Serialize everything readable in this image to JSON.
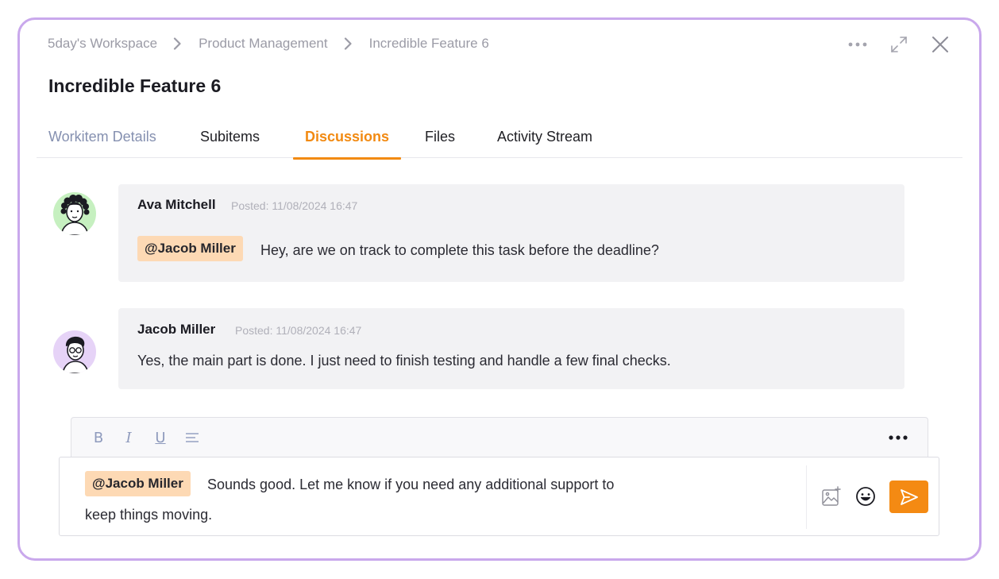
{
  "breadcrumb": {
    "items": [
      "5day's Workspace",
      "Product Management",
      "Incredible Feature 6"
    ]
  },
  "header": {
    "title": "Incredible Feature 6",
    "icons": [
      "more-horizontal-icon",
      "expand-icon",
      "close-icon"
    ]
  },
  "tabs": [
    {
      "label": "Workitem Details",
      "state": "dim"
    },
    {
      "label": "Subitems",
      "state": "normal"
    },
    {
      "label": "Discussions",
      "state": "active"
    },
    {
      "label": "Files",
      "state": "normal"
    },
    {
      "label": "Activity Stream",
      "state": "normal"
    }
  ],
  "messages": [
    {
      "author": "Ava Mitchell",
      "posted": "Posted: 11/08/2024 16:47",
      "mention": "@Jacob Miller",
      "text": "Hey, are we on track to complete this task before the deadline?"
    },
    {
      "author": "Jacob Miller",
      "posted": "Posted: 11/08/2024 16:47",
      "text": "Yes, the main part is done. I just need to finish testing and handle a few final checks."
    }
  ],
  "editor": {
    "toolbar": {
      "bold": "B",
      "italic": "I",
      "underline": "U",
      "more_icon": "more-horizontal-icon"
    },
    "mention": "@Jacob Miller",
    "text_line1": "Sounds good. Let me know if you need any additional support to",
    "text_line2": "keep things moving."
  },
  "colors": {
    "accent": "#f28a12",
    "mention_bg": "#fdd9b4",
    "border": "#c9a8ec",
    "bubble_bg": "#f2f2f4"
  }
}
